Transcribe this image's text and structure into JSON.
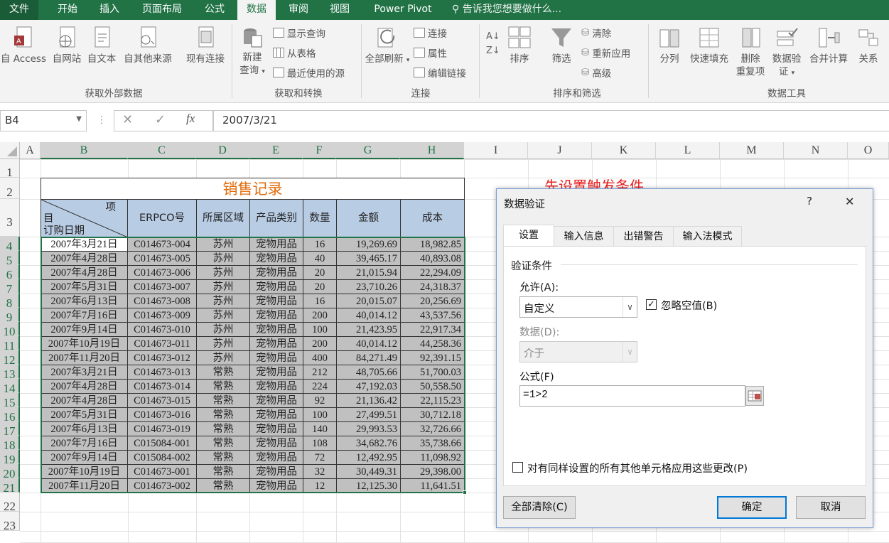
{
  "tabs": [
    "文件",
    "开始",
    "插入",
    "页面布局",
    "公式",
    "数据",
    "审阅",
    "视图",
    "Power Pivot"
  ],
  "tellme": "告诉我您想要做什么...",
  "ribbon": {
    "get_external": {
      "buttons": [
        "自 Access",
        "自网站",
        "自文本",
        "自其他来源",
        "现有连接"
      ],
      "label": "获取外部数据"
    },
    "transform": {
      "new_query": "新建",
      "new_query2": "查询",
      "show_query": "显示查询",
      "from_table": "从表格",
      "recent": "最近使用的源",
      "label": "获取和转换"
    },
    "connections": {
      "refresh_all": "全部刷新",
      "connections": "连接",
      "properties": "属性",
      "edit_links": "编辑链接",
      "label": "连接"
    },
    "sort_filter": {
      "sort": "排序",
      "filter": "筛选",
      "clear": "清除",
      "reapply": "重新应用",
      "advanced": "高级",
      "label": "排序和筛选"
    },
    "tools": {
      "buttons": [
        "分列",
        "快速填充",
        "删除",
        "数据验",
        "合并计算",
        "关系"
      ],
      "buttons2": [
        "",
        "",
        "重复项",
        "证",
        ""
      ],
      "label": "数据工具"
    }
  },
  "namebox": "B4",
  "formula": "2007/3/21",
  "columns": [
    "A",
    "B",
    "C",
    "D",
    "E",
    "F",
    "G",
    "H",
    "I",
    "J",
    "K",
    "L",
    "M",
    "N",
    "O"
  ],
  "rows": [
    "1",
    "2",
    "3",
    "4",
    "5",
    "6",
    "7",
    "8",
    "9",
    "10",
    "11",
    "12",
    "13",
    "14",
    "15",
    "16",
    "17",
    "18",
    "19",
    "20",
    "21",
    "22",
    "23"
  ],
  "table": {
    "title": "销售记录",
    "hdr_item": "项",
    "hdr_mu": "目",
    "hdr_date": "订购日期",
    "headers": [
      "ERPCO号",
      "所属区域",
      "产品类别",
      "数量",
      "金额",
      "成本"
    ],
    "rows": [
      [
        "2007年3月21日",
        "C014673-004",
        "苏州",
        "宠物用品",
        "16",
        "19,269.69",
        "18,982.85"
      ],
      [
        "2007年4月28日",
        "C014673-005",
        "苏州",
        "宠物用品",
        "40",
        "39,465.17",
        "40,893.08"
      ],
      [
        "2007年4月28日",
        "C014673-006",
        "苏州",
        "宠物用品",
        "20",
        "21,015.94",
        "22,294.09"
      ],
      [
        "2007年5月31日",
        "C014673-007",
        "苏州",
        "宠物用品",
        "20",
        "23,710.26",
        "24,318.37"
      ],
      [
        "2007年6月13日",
        "C014673-008",
        "苏州",
        "宠物用品",
        "16",
        "20,015.07",
        "20,256.69"
      ],
      [
        "2007年7月16日",
        "C014673-009",
        "苏州",
        "宠物用品",
        "200",
        "40,014.12",
        "43,537.56"
      ],
      [
        "2007年9月14日",
        "C014673-010",
        "苏州",
        "宠物用品",
        "100",
        "21,423.95",
        "22,917.34"
      ],
      [
        "2007年10月19日",
        "C014673-011",
        "苏州",
        "宠物用品",
        "200",
        "40,014.12",
        "44,258.36"
      ],
      [
        "2007年11月20日",
        "C014673-012",
        "苏州",
        "宠物用品",
        "400",
        "84,271.49",
        "92,391.15"
      ],
      [
        "2007年3月21日",
        "C014673-013",
        "常熟",
        "宠物用品",
        "212",
        "48,705.66",
        "51,700.03"
      ],
      [
        "2007年4月28日",
        "C014673-014",
        "常熟",
        "宠物用品",
        "224",
        "47,192.03",
        "50,558.50"
      ],
      [
        "2007年4月28日",
        "C014673-015",
        "常熟",
        "宠物用品",
        "92",
        "21,136.42",
        "22,115.23"
      ],
      [
        "2007年5月31日",
        "C014673-016",
        "常熟",
        "宠物用品",
        "100",
        "27,499.51",
        "30,712.18"
      ],
      [
        "2007年6月13日",
        "C014673-019",
        "常熟",
        "宠物用品",
        "140",
        "29,993.53",
        "32,726.66"
      ],
      [
        "2007年7月16日",
        "C015084-001",
        "常熟",
        "宠物用品",
        "108",
        "34,682.76",
        "35,738.66"
      ],
      [
        "2007年9月14日",
        "C015084-002",
        "常熟",
        "宠物用品",
        "72",
        "12,492.95",
        "11,098.92"
      ],
      [
        "2007年10月19日",
        "C014673-001",
        "常熟",
        "宠物用品",
        "32",
        "30,449.31",
        "29,398.00"
      ],
      [
        "2007年11月20日",
        "C014673-002",
        "常熟",
        "宠物用品",
        "12",
        "12,125.30",
        "11,641.51"
      ]
    ]
  },
  "annotation": "先设置触发条件",
  "dialog": {
    "title": "数据验证",
    "help": "?",
    "close": "✕",
    "tabs": [
      "设置",
      "输入信息",
      "出错警告",
      "输入法模式"
    ],
    "section": "验证条件",
    "allow_label": "允许(A):",
    "allow_value": "自定义",
    "ignore_blank": "忽略空值(B)",
    "data_label": "数据(D):",
    "data_value": "介于",
    "formula_label": "公式(F)",
    "formula_value": "=1>2",
    "apply_all": "对有同样设置的所有其他单元格应用这些更改(P)",
    "clear_all": "全部清除(C)",
    "ok": "确定",
    "cancel": "取消"
  }
}
